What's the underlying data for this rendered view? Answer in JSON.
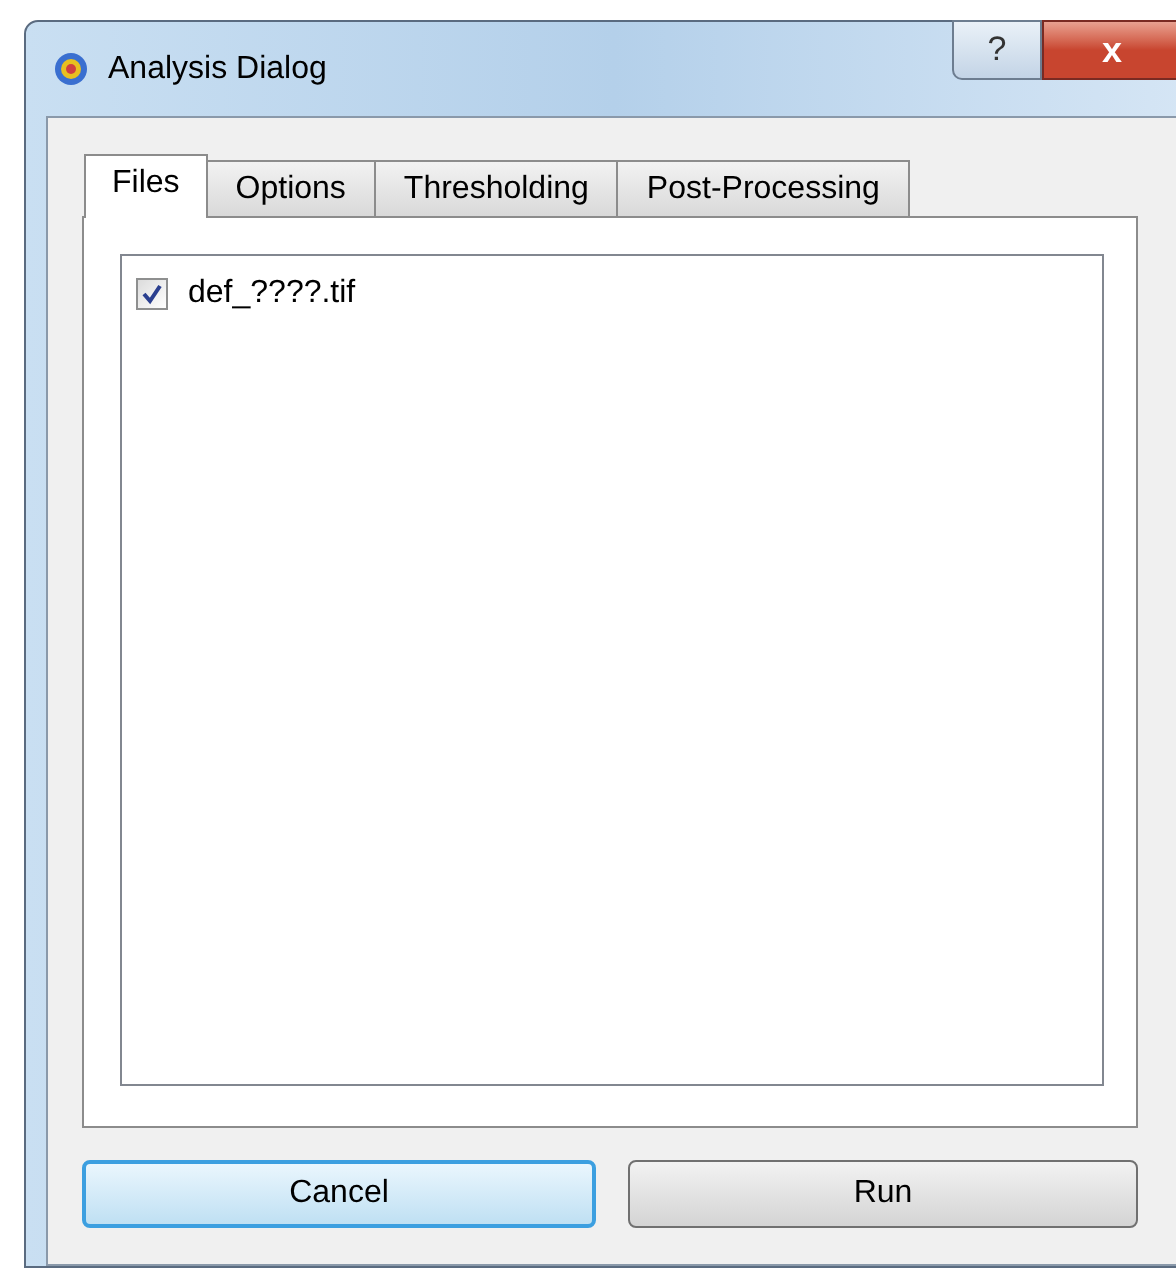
{
  "window": {
    "title": "Analysis Dialog",
    "help_button": "?",
    "close_button": "x"
  },
  "tabs": [
    {
      "label": "Files",
      "selected": true
    },
    {
      "label": "Options",
      "selected": false
    },
    {
      "label": "Thresholding",
      "selected": false
    },
    {
      "label": "Post-Processing",
      "selected": false
    }
  ],
  "files": [
    {
      "name": "def_????.tif",
      "checked": true
    }
  ],
  "buttons": [
    {
      "label": "Cancel",
      "focused": true
    },
    {
      "label": "Run",
      "focused": false
    }
  ]
}
